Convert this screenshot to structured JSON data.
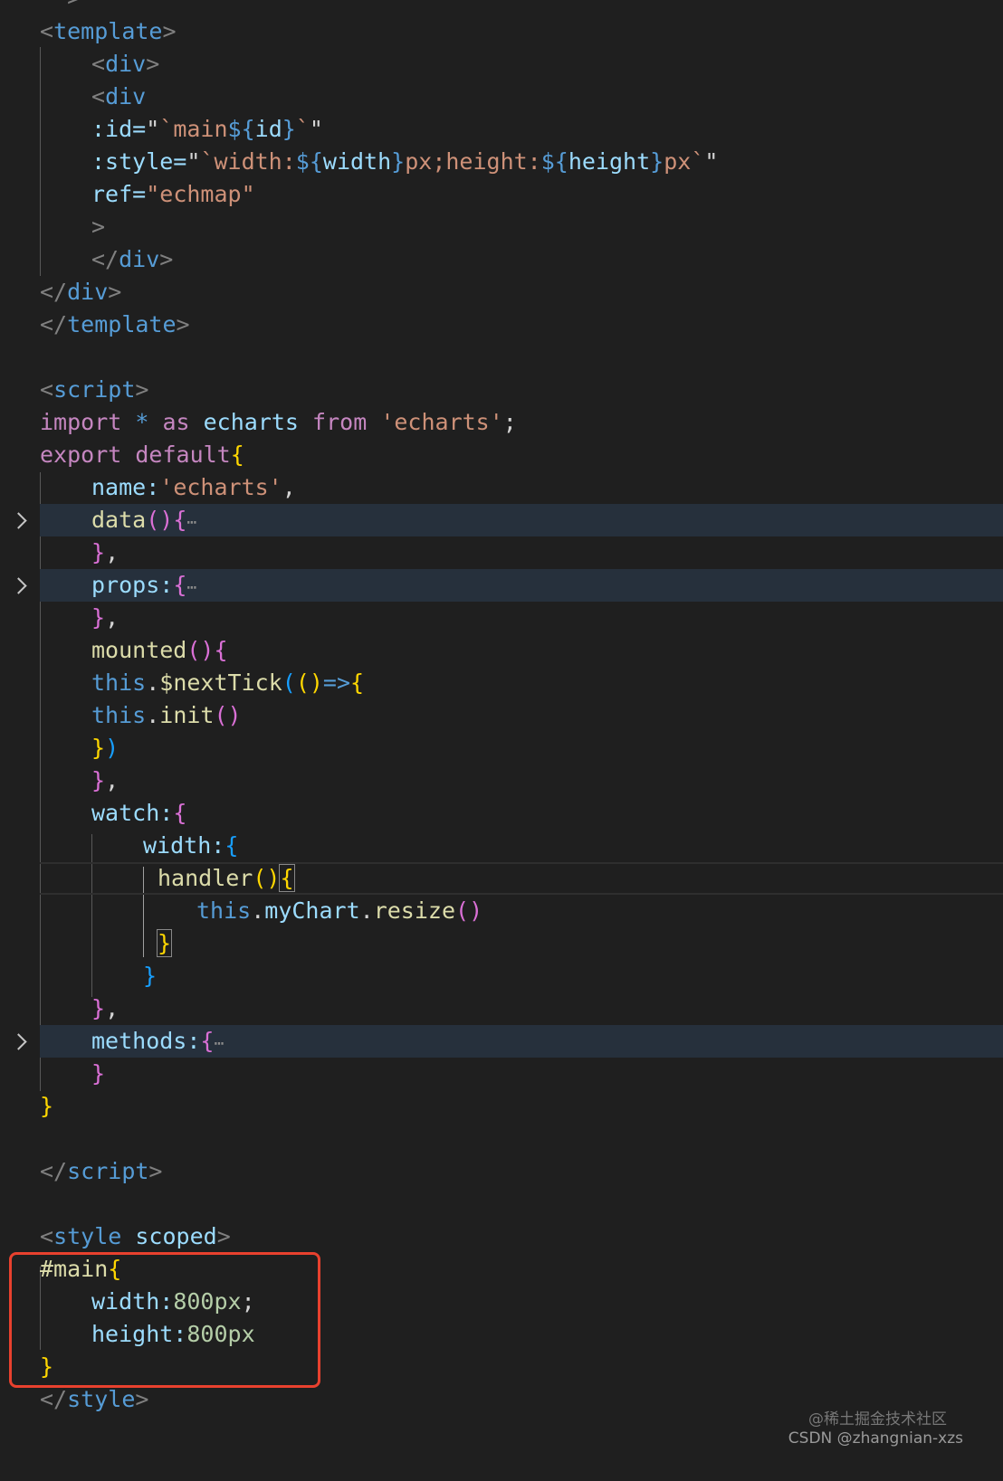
{
  "editor": {
    "theme": "dark",
    "background": "#1f1f1f",
    "folded_highlight_color": "#26303c",
    "annotation_color": "#e8412e",
    "lines": {
      "l0": "-->",
      "l1": {
        "open": "<",
        "tag": "template",
        "close": ">"
      },
      "l2": {
        "open": "<",
        "tag": "div",
        "close": ">"
      },
      "l3": {
        "open": "<",
        "tag": "div"
      },
      "l4": {
        "attr": ":id=",
        "q1": "\"",
        "tick1": "`main",
        "interp_open": "${",
        "var": "id",
        "interp_close": "}",
        "tick2": "`",
        "q2": "\""
      },
      "l5": {
        "attr": ":style=",
        "q1": "\"",
        "s1": "`width:",
        "io1": "${",
        "v1": "width",
        "ic1": "}",
        "s2": "px;height:",
        "io2": "${",
        "v2": "height",
        "ic2": "}",
        "s3": "px`",
        "q2": "\""
      },
      "l6": {
        "attr": "ref=",
        "val": "\"echmap\""
      },
      "l7": ">",
      "l8": {
        "open": "</",
        "tag": "div",
        "close": ">"
      },
      "l9": {
        "open": "</",
        "tag": "div",
        "close": ">"
      },
      "l10": {
        "open": "</",
        "tag": "template",
        "close": ">"
      },
      "l11": {
        "open": "<",
        "tag": "script",
        "close": ">"
      },
      "l12": {
        "kw1": "import",
        "star": " * ",
        "kw2": "as",
        "id": " echarts ",
        "kw3": "from",
        "sp": " ",
        "str": "'echarts'",
        "semi": ";"
      },
      "l13": {
        "kw1": "export",
        "kw2": " default",
        "brace": "{"
      },
      "l14": {
        "prop": "name:",
        "str": "'echarts'",
        "comma": ","
      },
      "l15": {
        "fn": "data",
        "parens": "()",
        "brace": "{",
        "ellipsis": "⋯"
      },
      "l16": {
        "brace": "}",
        "comma": ","
      },
      "l17": {
        "prop": "props:",
        "brace": "{",
        "ellipsis": "⋯"
      },
      "l18": {
        "brace": "}",
        "comma": ","
      },
      "l19": {
        "fn": "mounted",
        "parens": "()",
        "brace": "{"
      },
      "l20": {
        "this": "this",
        "dot": ".",
        "fn": "$nextTick",
        "p1": "(",
        "p2": "()",
        "arrow": "=>",
        "brace": "{"
      },
      "l21": {
        "this": "this",
        "dot": ".",
        "fn": "init",
        "parens": "()"
      },
      "l22": {
        "brace": "}",
        "paren": ")"
      },
      "l23": {
        "brace": "}",
        "comma": ","
      },
      "l24": {
        "prop": "watch:",
        "brace": "{"
      },
      "l25": {
        "prop": "width:",
        "brace": "{"
      },
      "l26": {
        "fn": "handler",
        "parens": "()",
        "brace": "{"
      },
      "l27": {
        "this": "this",
        "dot1": ".",
        "prop": "myChart",
        "dot2": ".",
        "fn": "resize",
        "parens": "()"
      },
      "l28": "}",
      "l29": "}",
      "l30": {
        "brace": "}",
        "comma": ","
      },
      "l31": {
        "prop": "methods:",
        "brace": "{",
        "ellipsis": "⋯"
      },
      "l32": "}",
      "l33": "}",
      "l34": {
        "open": "</",
        "tag": "script",
        "close": ">"
      },
      "l35": {
        "open": "<",
        "tag": "style",
        "attr": " scoped",
        "close": ">"
      },
      "l36": {
        "sel": "#main",
        "brace": "{"
      },
      "l37": {
        "prop": "width:",
        "num": "800px",
        "semi": ";"
      },
      "l38": {
        "prop": "height:",
        "num": "800px"
      },
      "l39": "}",
      "l40": {
        "open": "</",
        "tag": "style",
        "close": ">"
      }
    }
  },
  "watermark": {
    "line1": "@稀土掘金技术社区",
    "line2": "CSDN @zhangnian-xzs"
  }
}
